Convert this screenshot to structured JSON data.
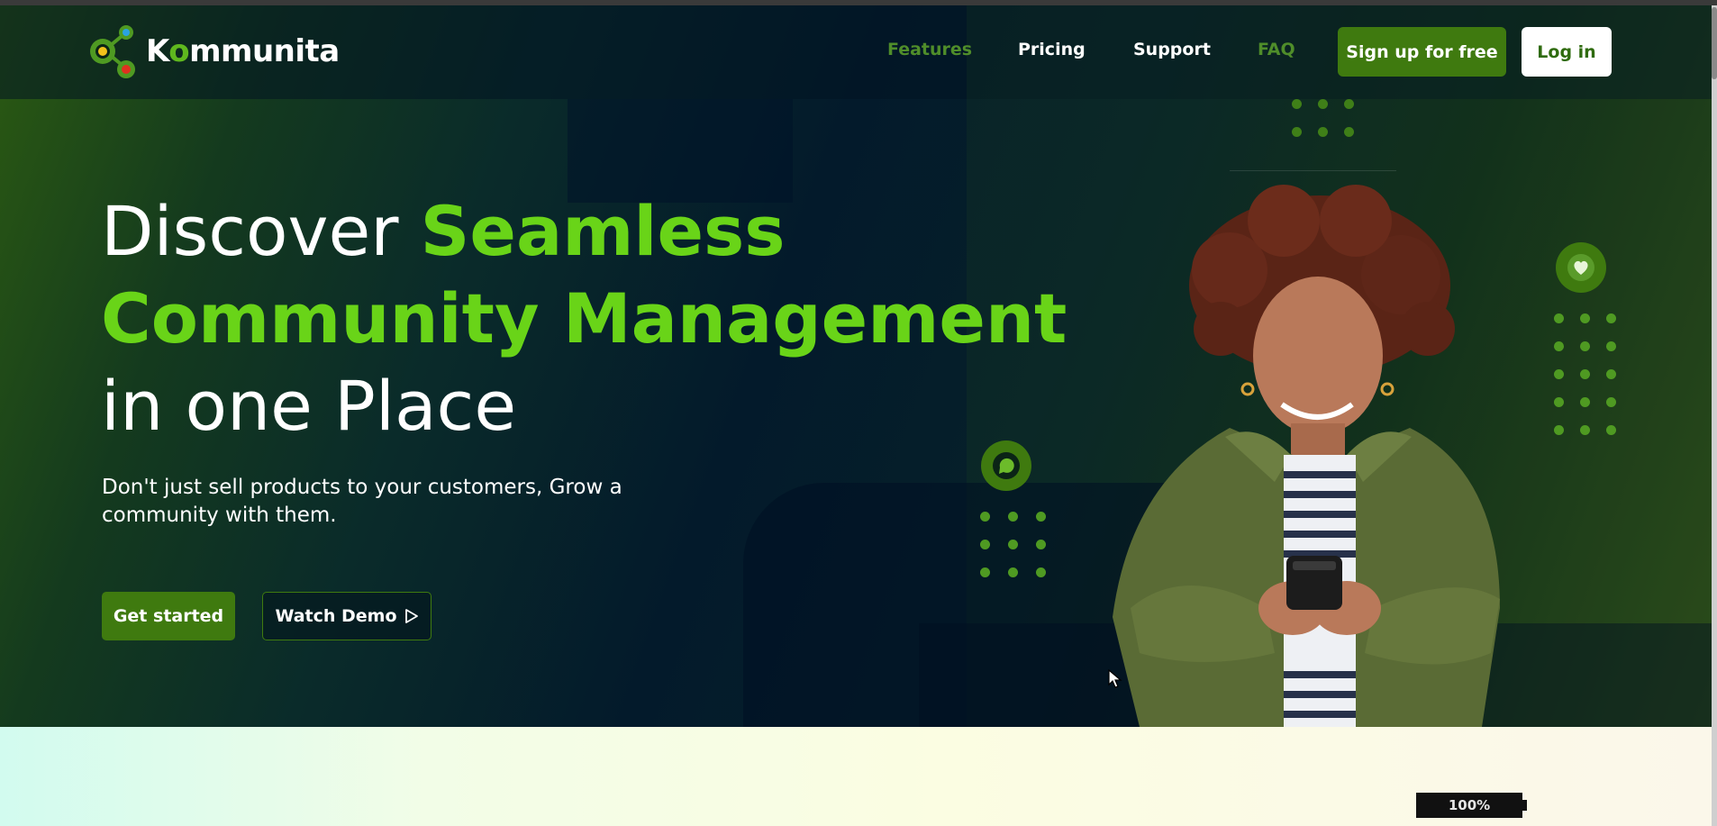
{
  "brand": {
    "name_prefix": "K",
    "name_o": "o",
    "name_suffix": "mmunita",
    "logo_icon": "molecule-logo-icon"
  },
  "nav": {
    "items": [
      {
        "label": "Features"
      },
      {
        "label": "Pricing"
      },
      {
        "label": "Support"
      },
      {
        "label": "FAQ"
      }
    ],
    "signup_label": "Sign up for free",
    "login_label": "Log in"
  },
  "hero": {
    "headline_plain_1": "Discover ",
    "headline_accent_1": "Seamless",
    "headline_accent_2": "Community Management",
    "headline_plain_2": "in one Place",
    "subheading": "Don't just sell products to your customers, Grow a community with them.",
    "cta_primary": "Get started",
    "cta_secondary": "Watch Demo",
    "cta_secondary_icon": "play-icon"
  },
  "decor": {
    "chat_badge_icon": "chat-bubble-icon",
    "heart_badge_icon": "heart-icon"
  },
  "status": {
    "zoom": "100%"
  },
  "colors": {
    "accent": "#69d418",
    "button": "#3f7a0f",
    "nav_muted": "#4f8d2a",
    "hero_dark": "#031a2b"
  }
}
